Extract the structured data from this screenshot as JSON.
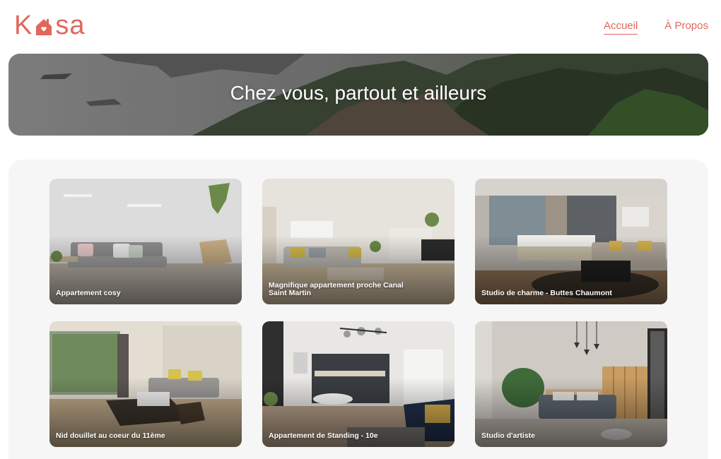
{
  "app": {
    "logo_text_start": "K",
    "logo_text_end": "sa",
    "brand_color": "#E0675D"
  },
  "nav": {
    "items": [
      {
        "label": "Accueil",
        "active": true
      },
      {
        "label": "À Propos",
        "active": false
      }
    ]
  },
  "banner": {
    "title": "Chez vous, partout et ailleurs"
  },
  "listings": [
    {
      "title": "Appartement cosy"
    },
    {
      "title": "Magnifique appartement proche Canal Saint Martin"
    },
    {
      "title": "Studio de charme - Buttes Chaumont"
    },
    {
      "title": "Nid douillet au coeur du 11ème"
    },
    {
      "title": "Appartement de Standing - 10e"
    },
    {
      "title": "Studio d'artiste"
    }
  ]
}
